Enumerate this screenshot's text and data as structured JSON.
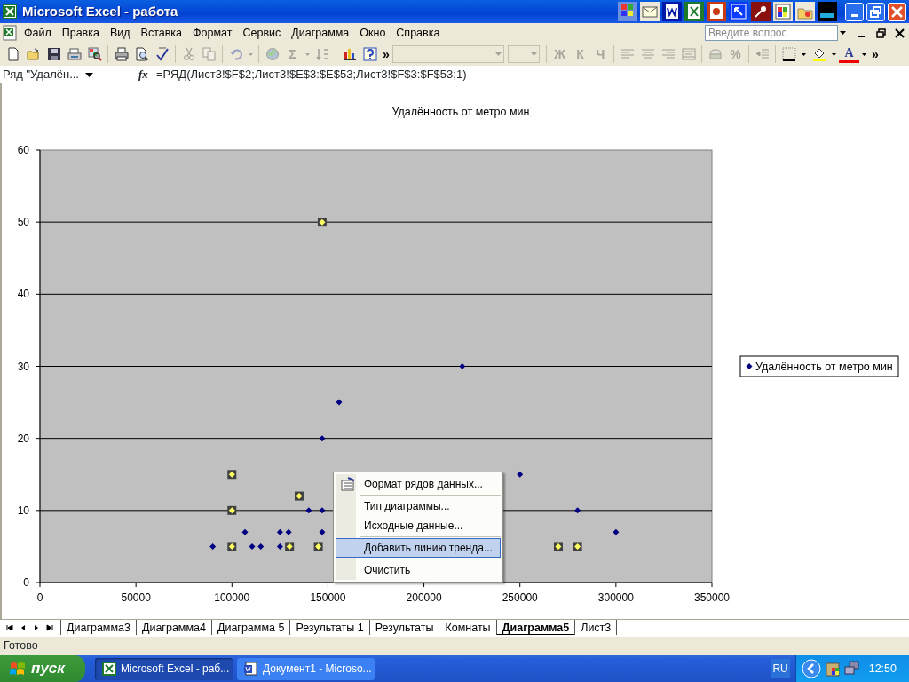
{
  "window": {
    "title": "Microsoft Excel - работа"
  },
  "menu": [
    {
      "label": "Файл"
    },
    {
      "label": "Правка"
    },
    {
      "label": "Вид"
    },
    {
      "label": "Вставка"
    },
    {
      "label": "Формат"
    },
    {
      "label": "Сервис"
    },
    {
      "label": "Диаграмма"
    },
    {
      "label": "Окно"
    },
    {
      "label": "Справка"
    }
  ],
  "help_box": {
    "placeholder": "Введите вопрос"
  },
  "toolbar": [
    {
      "kind": "button",
      "disabled": false
    },
    {
      "kind": "button",
      "disabled": false
    },
    {
      "kind": "button",
      "disabled": false
    },
    {
      "kind": "button",
      "disabled": false
    },
    {
      "kind": "button",
      "disabled": false
    },
    {
      "kind": "separator"
    },
    {
      "kind": "button",
      "disabled": false
    },
    {
      "kind": "button",
      "disabled": false
    },
    {
      "kind": "button",
      "disabled": false
    },
    {
      "kind": "separator"
    },
    {
      "kind": "button",
      "disabled": true
    },
    {
      "kind": "button",
      "disabled": true
    },
    {
      "kind": "separator"
    },
    {
      "kind": "button",
      "disabled": true
    },
    {
      "kind": "caret",
      "disabled": true
    },
    {
      "kind": "separator"
    },
    {
      "kind": "button",
      "disabled": true
    },
    {
      "kind": "text",
      "label": "Σ",
      "disabled": true
    },
    {
      "kind": "caret",
      "disabled": true
    },
    {
      "kind": "button",
      "disabled": true
    },
    {
      "kind": "separator"
    },
    {
      "kind": "button",
      "disabled": false
    },
    {
      "kind": "button",
      "disabled": false
    },
    {
      "kind": "more",
      "label": "»"
    },
    {
      "kind": "font_combo",
      "disabled": true
    },
    {
      "kind": "size_combo",
      "disabled": true
    },
    {
      "kind": "separator"
    },
    {
      "kind": "text",
      "label": "Ж",
      "disabled": true
    },
    {
      "kind": "text",
      "label": "К",
      "disabled": true
    },
    {
      "kind": "text",
      "label": "Ч",
      "disabled": true
    },
    {
      "kind": "separator"
    },
    {
      "kind": "button",
      "disabled": true
    },
    {
      "kind": "button",
      "disabled": true
    },
    {
      "kind": "button",
      "disabled": true
    },
    {
      "kind": "button",
      "disabled": true
    },
    {
      "kind": "separator"
    },
    {
      "kind": "button",
      "disabled": true
    },
    {
      "kind": "text",
      "label": "%",
      "disabled": true
    },
    {
      "kind": "separator"
    },
    {
      "kind": "button",
      "disabled": true
    },
    {
      "kind": "separator"
    },
    {
      "kind": "button",
      "disabled": false
    },
    {
      "kind": "caret",
      "disabled": false
    },
    {
      "kind": "button",
      "disabled": false
    },
    {
      "kind": "caret",
      "disabled": false
    },
    {
      "kind": "text",
      "label": "A",
      "disabled": false
    },
    {
      "kind": "caret",
      "disabled": false
    },
    {
      "kind": "more",
      "label": "»"
    }
  ],
  "formula_bar": {
    "name_box": "Ряд \"Удалён...",
    "fx": "fx",
    "formula": "=РЯД(Лист3!$F$2;Лист3!$E$3:$E$53;Лист3!$F$3:$F$53;1)"
  },
  "chart": {
    "chart_data": {
      "type": "scatter",
      "title": "Удалённость от метро мин",
      "x": [
        90000,
        106800,
        110500,
        115000,
        125000,
        125000,
        129500,
        140000,
        147000,
        147000,
        147000,
        155800,
        220000,
        250000,
        280000,
        300000,
        100000,
        100000,
        100000,
        135000,
        130000,
        145000,
        147000,
        270000,
        280000
      ],
      "series": [
        {
          "name": "Удалённость от метро мин",
          "color": "#000080",
          "values": [
            5,
            7,
            5,
            5,
            7,
            5,
            7,
            10,
            10,
            7,
            20,
            25,
            30,
            15,
            10,
            7,
            15,
            10,
            5,
            12,
            5,
            5,
            50,
            5,
            5
          ]
        }
      ],
      "xlim": [
        0,
        350000
      ],
      "ylim": [
        0,
        60
      ],
      "xticks": [
        0,
        50000,
        100000,
        150000,
        200000,
        250000,
        300000,
        350000
      ],
      "yticks": [
        0,
        10,
        20,
        30,
        40,
        50,
        60
      ],
      "grid": true
    },
    "point_handles": [
      false,
      false,
      false,
      false,
      false,
      false,
      false,
      false,
      false,
      false,
      false,
      false,
      false,
      false,
      false,
      false,
      true,
      true,
      true,
      true,
      true,
      true,
      true,
      true,
      true
    ]
  },
  "context_menu": [
    {
      "label": "Формат рядов данных...",
      "icon": true,
      "separator_before": false,
      "selected": false
    },
    {
      "label": "Тип диаграммы...",
      "icon": false,
      "separator_before": true,
      "selected": false
    },
    {
      "label": "Исходные данные...",
      "icon": false,
      "separator_before": false,
      "selected": false
    },
    {
      "label": "Добавить линию тренда...",
      "icon": false,
      "separator_before": true,
      "selected": true
    },
    {
      "label": "Очистить",
      "icon": false,
      "separator_before": true,
      "selected": false
    }
  ],
  "sheet_tabs": [
    {
      "label": "Диаграмма3",
      "selected": false
    },
    {
      "label": "Диаграмма4",
      "selected": false
    },
    {
      "label": "Диаграмма 5",
      "selected": false
    },
    {
      "label": "Результаты 1",
      "selected": false
    },
    {
      "label": "Результаты",
      "selected": false
    },
    {
      "label": "Комнаты",
      "selected": false
    },
    {
      "label": "Диаграмма5",
      "selected": true
    },
    {
      "label": "Лист3",
      "selected": false
    }
  ],
  "status_bar": "Готово",
  "taskbar": {
    "start": "пуск",
    "tasks": [
      {
        "label": "Microsoft Excel - раб...",
        "selected": true
      },
      {
        "label": "Документ1 - Microso...",
        "selected": false
      }
    ],
    "language": "RU",
    "clock": "12:50"
  }
}
